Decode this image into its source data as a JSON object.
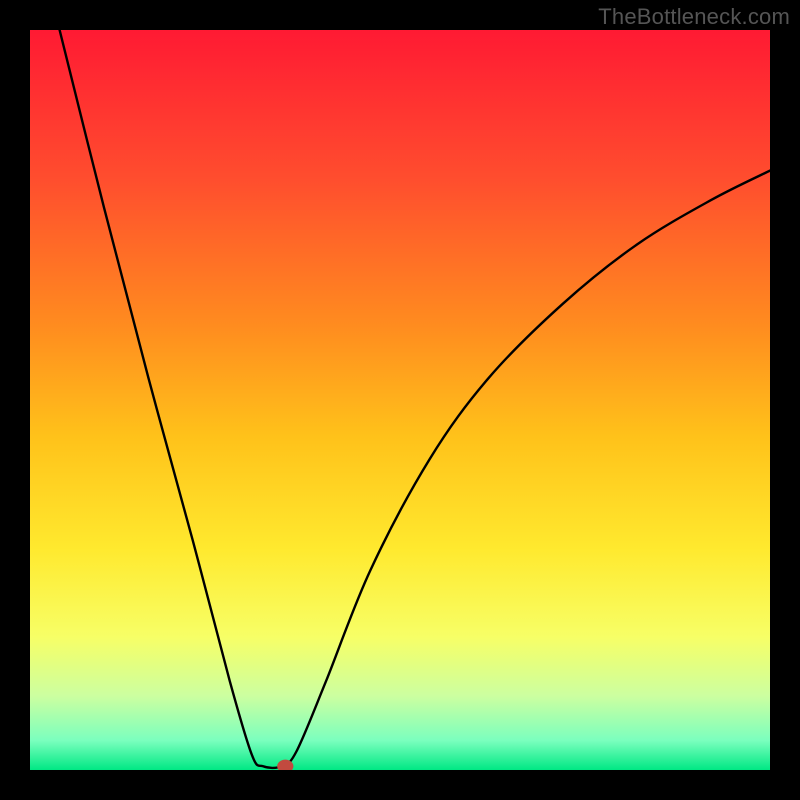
{
  "watermark": "TheBottleneck.com",
  "chart_data": {
    "type": "line",
    "title": "",
    "xlabel": "",
    "ylabel": "",
    "xlim": [
      0,
      100
    ],
    "ylim": [
      0,
      100
    ],
    "grid": false,
    "legend": false,
    "background_gradient": {
      "stops": [
        {
          "pos": 0.0,
          "color": "#ff1a33"
        },
        {
          "pos": 0.2,
          "color": "#ff4d2e"
        },
        {
          "pos": 0.4,
          "color": "#ff8c1f"
        },
        {
          "pos": 0.55,
          "color": "#ffc21a"
        },
        {
          "pos": 0.7,
          "color": "#ffe92e"
        },
        {
          "pos": 0.82,
          "color": "#f7ff66"
        },
        {
          "pos": 0.9,
          "color": "#ccffa0"
        },
        {
          "pos": 0.96,
          "color": "#7bffbe"
        },
        {
          "pos": 1.0,
          "color": "#00e884"
        }
      ]
    },
    "series": [
      {
        "name": "bottleneck-curve",
        "stroke": "#000000",
        "points": [
          {
            "x": 4.0,
            "y": 100.0
          },
          {
            "x": 10.0,
            "y": 76.0
          },
          {
            "x": 16.0,
            "y": 53.0
          },
          {
            "x": 22.0,
            "y": 31.0
          },
          {
            "x": 27.0,
            "y": 12.0
          },
          {
            "x": 30.0,
            "y": 2.0
          },
          {
            "x": 31.5,
            "y": 0.5
          },
          {
            "x": 34.0,
            "y": 0.5
          },
          {
            "x": 36.0,
            "y": 2.5
          },
          {
            "x": 40.0,
            "y": 12.0
          },
          {
            "x": 46.0,
            "y": 27.0
          },
          {
            "x": 54.0,
            "y": 42.0
          },
          {
            "x": 62.0,
            "y": 53.0
          },
          {
            "x": 72.0,
            "y": 63.0
          },
          {
            "x": 82.0,
            "y": 71.0
          },
          {
            "x": 92.0,
            "y": 77.0
          },
          {
            "x": 100.0,
            "y": 81.0
          }
        ]
      }
    ],
    "marker": {
      "name": "optimum-marker",
      "x": 34.5,
      "y": 0.5,
      "rx": 1.1,
      "ry": 0.9,
      "fill": "#c24a3f"
    }
  }
}
